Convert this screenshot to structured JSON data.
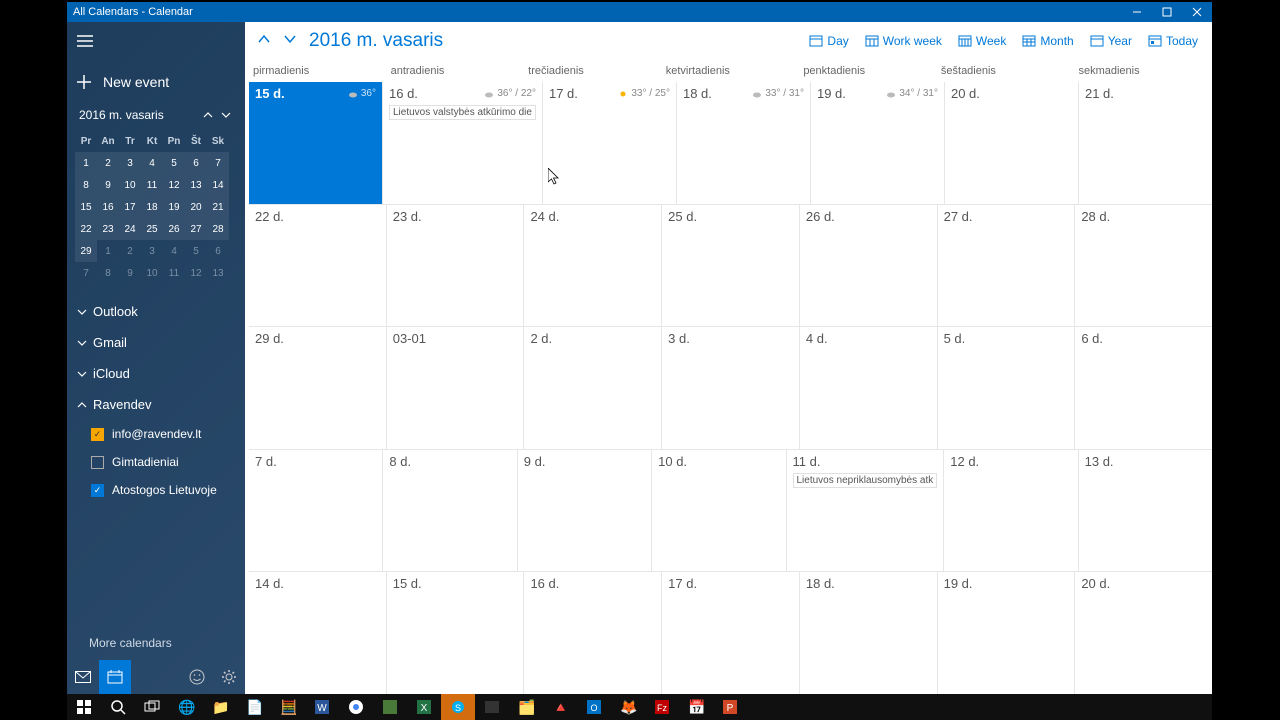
{
  "window": {
    "title": "All Calendars - Calendar"
  },
  "sidebar": {
    "new_event": "New event",
    "month_label": "2016 m. vasaris",
    "dow": [
      "Pr",
      "An",
      "Tr",
      "Kt",
      "Pn",
      "Št",
      "Sk"
    ],
    "weeks": [
      [
        "1",
        "2",
        "3",
        "4",
        "5",
        "6",
        "7"
      ],
      [
        "8",
        "9",
        "10",
        "11",
        "12",
        "13",
        "14"
      ],
      [
        "15",
        "16",
        "17",
        "18",
        "19",
        "20",
        "21"
      ],
      [
        "22",
        "23",
        "24",
        "25",
        "26",
        "27",
        "28"
      ],
      [
        "29",
        "1",
        "2",
        "3",
        "4",
        "5",
        "6"
      ],
      [
        "7",
        "8",
        "9",
        "10",
        "11",
        "12",
        "13"
      ]
    ],
    "accounts": {
      "outlook": "Outlook",
      "gmail": "Gmail",
      "icloud": "iCloud",
      "ravendev": "Ravendev"
    },
    "ravendev_items": {
      "info": "info@ravendev.lt",
      "gimtadieniai": "Gimtadieniai",
      "atostogos": "Atostogos Lietuvoje"
    },
    "more": "More calendars"
  },
  "main": {
    "title": "2016 m. vasaris",
    "views": {
      "day": "Day",
      "work_week": "Work week",
      "week": "Week",
      "month": "Month",
      "year": "Year",
      "today": "Today"
    },
    "dow": [
      "pirmadienis",
      "antradienis",
      "trečiadienis",
      "ketvirtadienis",
      "penktadienis",
      "šeštadienis",
      "sekmadienis"
    ],
    "rows": [
      [
        {
          "n": "15 d.",
          "today": true,
          "w": "36°",
          "wi": "cloud"
        },
        {
          "n": "16 d.",
          "w": "36° / 22°",
          "wi": "cloud",
          "ev": "Lietuvos valstybės atkūrimo die"
        },
        {
          "n": "17 d.",
          "w": "33° / 25°",
          "wi": "sun"
        },
        {
          "n": "18 d.",
          "w": "33° / 31°",
          "wi": "cloud"
        },
        {
          "n": "19 d.",
          "w": "34° / 31°",
          "wi": "cloud"
        },
        {
          "n": "20 d."
        },
        {
          "n": "21 d."
        }
      ],
      [
        {
          "n": "22 d."
        },
        {
          "n": "23 d."
        },
        {
          "n": "24 d."
        },
        {
          "n": "25 d."
        },
        {
          "n": "26 d."
        },
        {
          "n": "27 d."
        },
        {
          "n": "28 d."
        }
      ],
      [
        {
          "n": "29 d."
        },
        {
          "n": "03-01"
        },
        {
          "n": "2 d."
        },
        {
          "n": "3 d."
        },
        {
          "n": "4 d."
        },
        {
          "n": "5 d."
        },
        {
          "n": "6 d."
        }
      ],
      [
        {
          "n": "7 d."
        },
        {
          "n": "8 d."
        },
        {
          "n": "9 d."
        },
        {
          "n": "10 d."
        },
        {
          "n": "11 d.",
          "ev": "Lietuvos nepriklausomybės atk"
        },
        {
          "n": "12 d."
        },
        {
          "n": "13 d."
        }
      ],
      [
        {
          "n": "14 d."
        },
        {
          "n": "15 d."
        },
        {
          "n": "16 d."
        },
        {
          "n": "17 d."
        },
        {
          "n": "18 d."
        },
        {
          "n": "19 d."
        },
        {
          "n": "20 d."
        }
      ]
    ]
  }
}
